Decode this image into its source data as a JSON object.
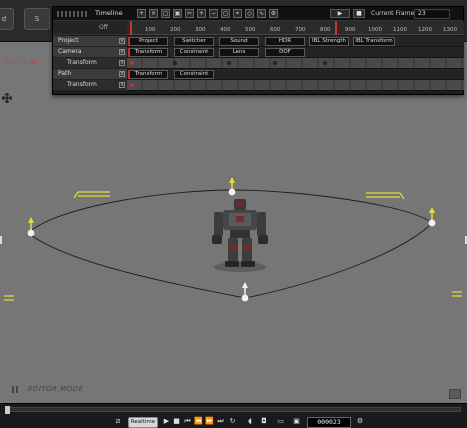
{
  "top_tabs": [
    "d",
    "S"
  ],
  "viewport": {
    "fps_text": "FPS: 0.00",
    "editor_mode": "EDITOR MODE"
  },
  "timeline": {
    "title": "Timeline",
    "subtab": "Off",
    "current_frame_label": "Current Frame:",
    "current_frame": "23",
    "ruler_ticks": [
      "100",
      "200",
      "300",
      "400",
      "500",
      "600",
      "700",
      "800",
      "900",
      "1000",
      "1100",
      "1200",
      "1300"
    ],
    "rows": [
      {
        "label": "Project",
        "clips": [
          "Project",
          "Switcher",
          "Sound",
          "HDR",
          "IBL Strength",
          "IBL Transform"
        ]
      },
      {
        "label": "Camera",
        "clips": [
          "Transform",
          "Constraint",
          "Lens",
          "DOF"
        ]
      },
      {
        "label": "Transform",
        "clips": []
      },
      {
        "label": "Path",
        "clips": [
          "Transform",
          "Constraint"
        ]
      },
      {
        "label": "Transform",
        "clips": []
      }
    ]
  },
  "transport": {
    "realtime_label": "Realtime",
    "frame_counter": "000023",
    "buttons": [
      "play",
      "stop",
      "go-to-start",
      "previous-frame",
      "next-frame",
      "go-to-end",
      "loop"
    ]
  },
  "colors": {
    "accent_red": "#c43030",
    "gizmo_yellow": "#e6dc3a",
    "path_line": "#1e1e1e"
  }
}
